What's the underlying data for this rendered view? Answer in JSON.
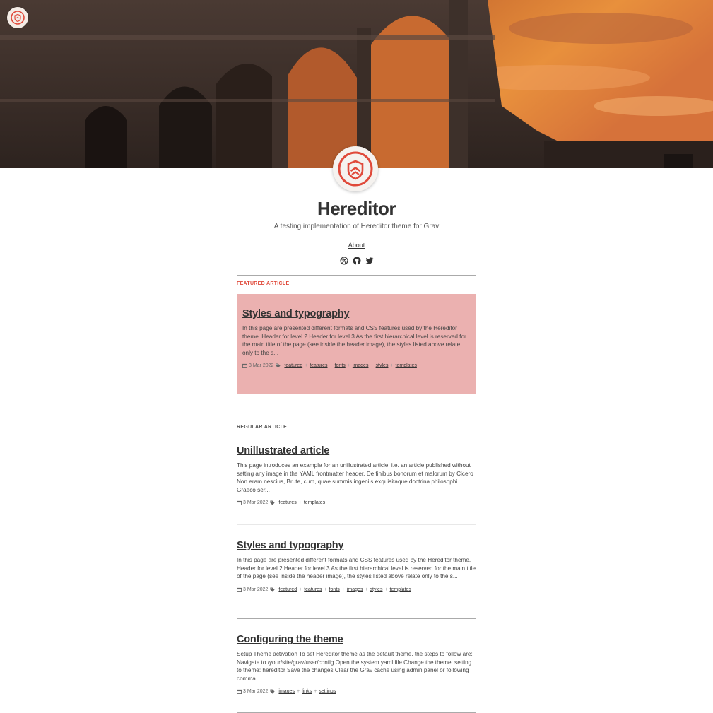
{
  "site": {
    "title": "Hereditor",
    "subtitle": "A testing implementation of Hereditor theme for Grav",
    "about_label": "About",
    "brand_color": "#e04a3b",
    "social_icons": [
      "dribbble-icon",
      "github-icon",
      "twitter-icon"
    ]
  },
  "featured": {
    "section_label": "Featured article",
    "card_color": "#ebb1b0",
    "title": "Styles and typography",
    "excerpt": "In this page are presented different formats and CSS features used by the Hereditor theme. Header for level 2 Header for level 3 As the first hierarchical level is reserved for the main title of the page (see inside the header image), the styles listed above relate only to the s...",
    "date": "3 Mar 2022",
    "tags": [
      "featured",
      "features",
      "fonts",
      "images",
      "styles",
      "templates"
    ]
  },
  "regular": {
    "section_label": "Regular article",
    "articles": [
      {
        "title": "Unillustrated article",
        "excerpt": "This page introduces an example for an unillustrated article, i.e. an article published without setting any image in the YAML frontmatter header. De finibus bonorum et malorum by Cicero Non eram nescius, Brute, cum, quae summis ingeniis exquisitaque doctrina philosophi Graeco ser...",
        "date": "3 Mar 2022",
        "tags": [
          "features",
          "templates"
        ]
      },
      {
        "title": "Styles and typography",
        "excerpt": "In this page are presented different formats and CSS features used by the Hereditor theme. Header for level 2 Header for level 3 As the first hierarchical level is reserved for the main title of the page (see inside the header image), the styles listed above relate only to the s...",
        "date": "3 Mar 2022",
        "tags": [
          "featured",
          "features",
          "fonts",
          "images",
          "styles",
          "templates"
        ]
      },
      {
        "title": "Configuring the theme",
        "excerpt": "Setup Theme activation To set Hereditor theme as the default theme, the steps to follow are: Navigate to /your/site/grav/user/config Open the system.yaml file Change the theme: setting to theme: hereditor Save the changes Clear the Grav cache using admin panel or following comma...",
        "date": "3 Mar 2022",
        "tags": [
          "images",
          "links",
          "settings"
        ]
      }
    ]
  }
}
